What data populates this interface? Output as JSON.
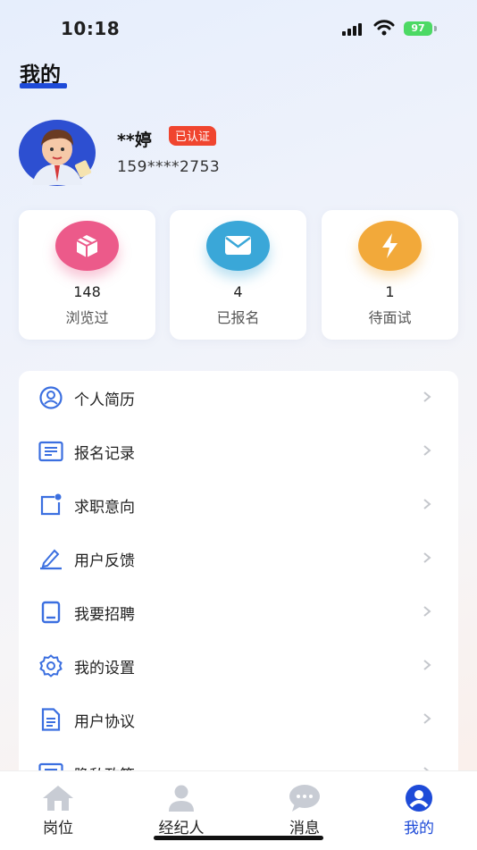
{
  "status_bar": {
    "time": "10:18",
    "battery": "97"
  },
  "header": {
    "title": "我的"
  },
  "profile": {
    "name": "**婷",
    "verified_label": "已认证",
    "phone": "159****2753"
  },
  "stats": [
    {
      "icon": "box-icon",
      "count": "148",
      "label": "浏览过",
      "color": "#ec5a8a"
    },
    {
      "icon": "mail-icon",
      "count": "4",
      "label": "已报名",
      "color": "#3aa7d8"
    },
    {
      "icon": "lightning-icon",
      "count": "1",
      "label": "待面试",
      "color": "#f2a93a"
    }
  ],
  "menu": [
    {
      "icon": "resume-icon",
      "label": "个人简历"
    },
    {
      "icon": "record-icon",
      "label": "报名记录"
    },
    {
      "icon": "intention-icon",
      "label": "求职意向"
    },
    {
      "icon": "feedback-icon",
      "label": "用户反馈"
    },
    {
      "icon": "tablet-icon",
      "label": "我要招聘"
    },
    {
      "icon": "settings-icon",
      "label": "我的设置"
    },
    {
      "icon": "document-icon",
      "label": "用户协议"
    },
    {
      "icon": "privacy-icon",
      "label": "隐私政策"
    }
  ],
  "tabbar": [
    {
      "icon": "home-icon",
      "label": "岗位",
      "active": false
    },
    {
      "icon": "agent-icon",
      "label": "经纪人",
      "active": false
    },
    {
      "icon": "message-icon",
      "label": "消息",
      "active": false
    },
    {
      "icon": "profile-icon",
      "label": "我的",
      "active": true
    }
  ],
  "colors": {
    "accent": "#1e4bd8",
    "menu_icon": "#3b6fe0",
    "badge": "#f0452f",
    "tab_inactive": "#c8ccd4"
  }
}
